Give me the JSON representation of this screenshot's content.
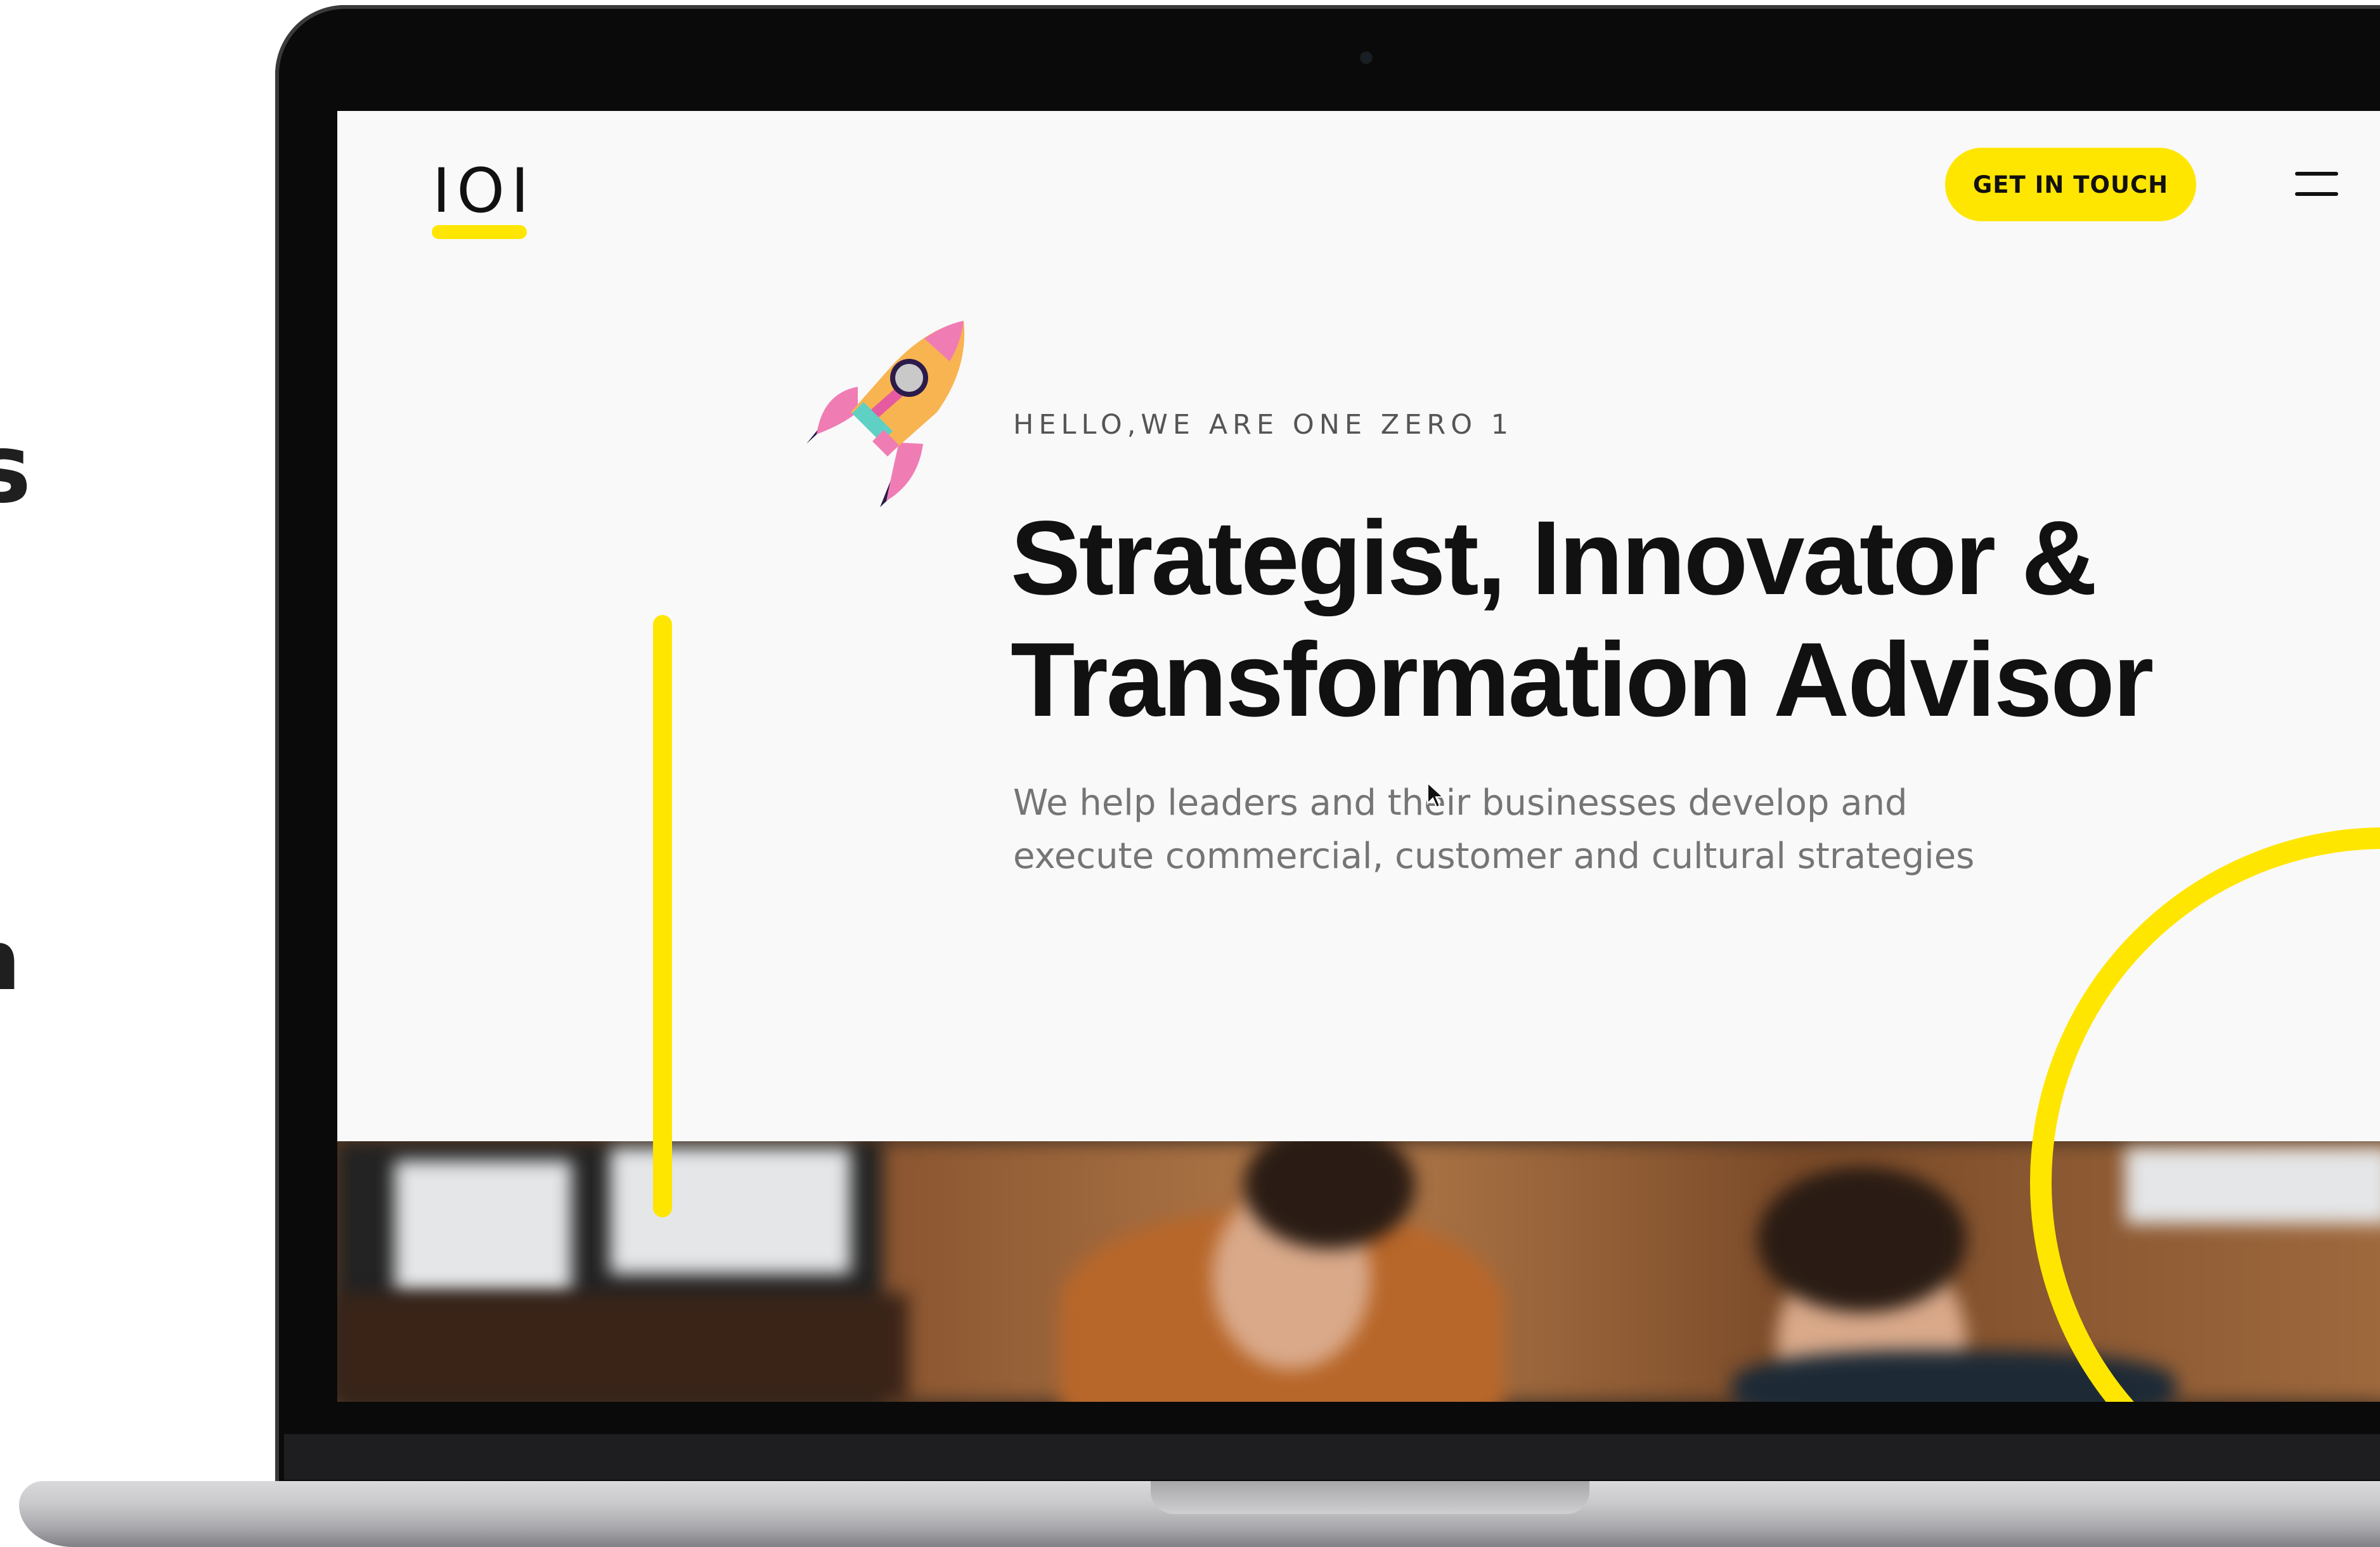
{
  "left_fragments": {
    "line1": "s",
    "line2": "n"
  },
  "header": {
    "logo": "IOI",
    "cta_label": "GET IN TOUCH"
  },
  "hero": {
    "eyebrow": "HELLO,WE ARE ONE ZERO 1",
    "headline_line1": "Strategist, Innovator &",
    "headline_line2": "Transformation Advisor",
    "subtext_line1": "We help leaders and their businesses develop and",
    "subtext_line2": "execute commercial, customer and cultural strategies"
  },
  "colors": {
    "accent": "#ffe600",
    "text_dark": "#111111",
    "text_muted": "#757575",
    "screen_bg": "#f9f9f9"
  },
  "icons": {
    "rocket": "rocket-icon",
    "menu": "hamburger-menu-icon",
    "cursor": "mouse-cursor-icon"
  }
}
